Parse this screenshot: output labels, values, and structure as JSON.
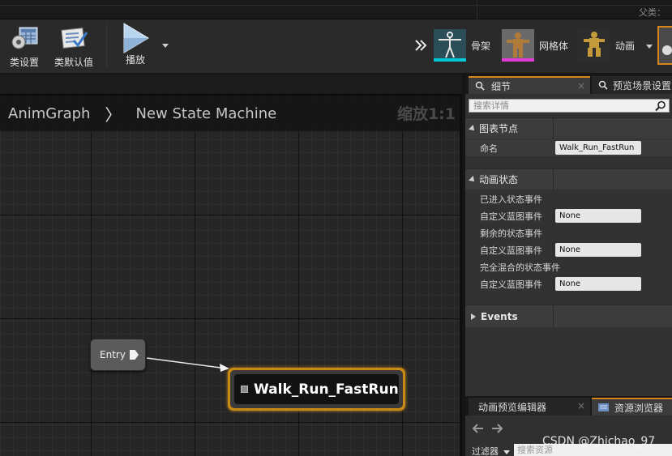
{
  "titlebar": {
    "parent_label": "父类："
  },
  "toolbar": {
    "class_settings_label": "类设置",
    "class_defaults_label": "类默认值",
    "play_label": "播放",
    "overflow_icon": "double-chevron-right",
    "modes": [
      {
        "label": "骨架"
      },
      {
        "label": "网格体"
      },
      {
        "label": "动画"
      }
    ]
  },
  "graph": {
    "breadcrumbs": [
      "AnimGraph",
      "New State Machine"
    ],
    "breadcrumb_separator": "〉",
    "zoom_label": "缩放1:1",
    "entry_node": {
      "label": "Entry"
    },
    "state_node": {
      "label": "Walk_Run_FastRun",
      "accent": "#c88a12"
    }
  },
  "panel": {
    "tabs": [
      {
        "label": "细节",
        "close": "×"
      },
      {
        "label": "预览场景设置"
      }
    ],
    "search_placeholder": "搜索详情",
    "categories": [
      {
        "title": "图表节点",
        "rows": [
          {
            "label": "命名",
            "value": "Walk_Run_FastRun"
          }
        ]
      },
      {
        "title": "动画状态",
        "rows": [
          {
            "label": "已进入状态事件"
          },
          {
            "label": "自定义蓝图事件",
            "value": "None"
          },
          {
            "label": "剩余的状态事件"
          },
          {
            "label": "自定义蓝图事件",
            "value": "None"
          },
          {
            "label": "完全混合的状态事件"
          },
          {
            "label": "自定义蓝图事件",
            "value": "None"
          }
        ]
      },
      {
        "title": "Events"
      }
    ],
    "bottom_tabs": [
      {
        "label": "动画预览编辑器",
        "close": "×"
      },
      {
        "label": "资源浏览器"
      }
    ],
    "filter_label": "过滤器",
    "asset_search_placeholder": "搜索资源"
  },
  "watermark": "CSDN @Zhichao_97"
}
